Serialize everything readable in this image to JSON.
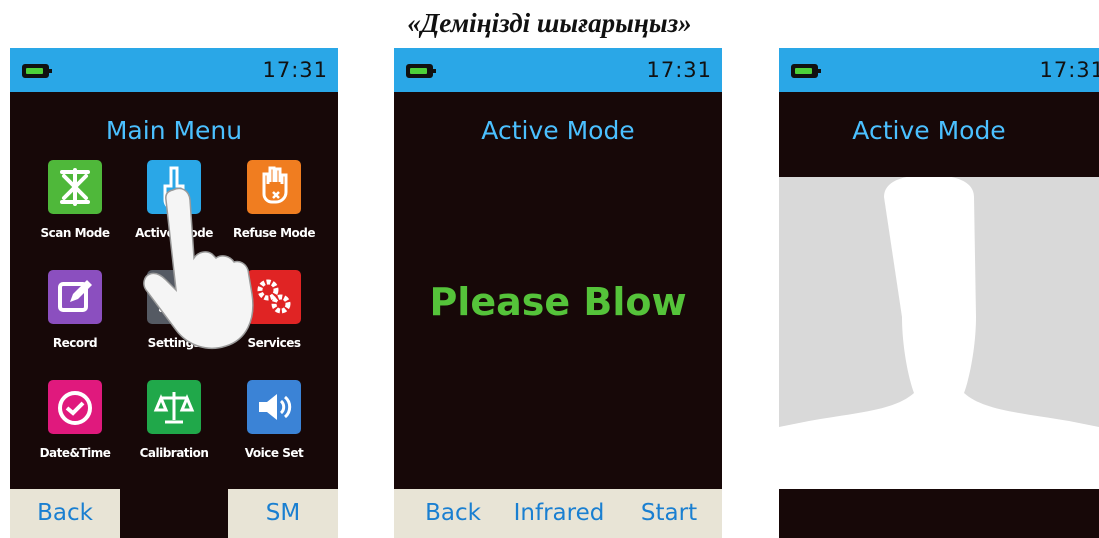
{
  "caption": "«Деміңізді шығарыңыз»",
  "colors": {
    "statusbar": "#2aa7e7",
    "screen_bg": "#170808",
    "title_blue": "#4bc0ff",
    "softkey_text": "#1a7fd1",
    "softkey_bg": "#e8e4d6",
    "please_blow": "#55c33a"
  },
  "screens": [
    {
      "time": "17:31",
      "title": "Main Menu",
      "menu": [
        {
          "label": "Scan Mode",
          "icon": "scan-icon",
          "color": "#4fb83a"
        },
        {
          "label": "Active Mode",
          "icon": "finger-icon",
          "color": "#2aa7e7"
        },
        {
          "label": "Refuse Mode",
          "icon": "hand-stop-icon",
          "color": "#f07d20"
        },
        {
          "label": "Record",
          "icon": "edit-icon",
          "color": "#8b4fbf"
        },
        {
          "label": "Settings",
          "icon": "tools-icon",
          "color": "#555a63"
        },
        {
          "label": "Services",
          "icon": "gears-icon",
          "color": "#e02424"
        },
        {
          "label": "Date&Time",
          "icon": "clock-icon",
          "color": "#e0197d"
        },
        {
          "label": "Calibration",
          "icon": "scale-icon",
          "color": "#20a84a"
        },
        {
          "label": "Voice Set",
          "icon": "speaker-icon",
          "color": "#3b83d6"
        }
      ],
      "softkeys": {
        "left": "Back",
        "right": "SM"
      }
    },
    {
      "time": "17:31",
      "title": "Active Mode",
      "message": "Please Blow",
      "softkeys": {
        "left": "Back",
        "center": "Infrared",
        "right": "Start"
      }
    },
    {
      "time": "17:31",
      "title": "Active Mode"
    }
  ]
}
